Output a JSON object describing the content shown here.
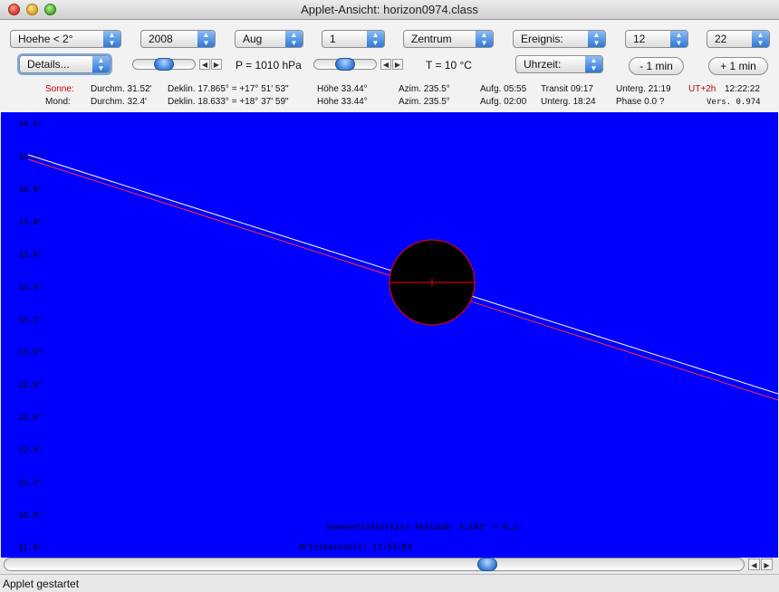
{
  "window": {
    "title": "Applet-Ansicht: horizon0974.class"
  },
  "controls": {
    "height_select": "Hoehe < 2°",
    "year_select": "2008",
    "month_select": "Aug",
    "day_select": "1",
    "center_select": "Zentrum",
    "event_select": "Ereignis:",
    "hour_select": "12",
    "minute_select": "22",
    "details_select": "Details...",
    "time_select": "Uhrzeit:",
    "pressure_label": "P = 1010 hPa",
    "temperature_label": "T = 10 °C",
    "minus_button": "- 1 min",
    "plus_button": "+ 1 min"
  },
  "sun": {
    "label": "Sonne:",
    "diameter": "Durchm. 31.52'",
    "declination": "Deklin. 17.865° = +17° 51' 53\"",
    "altitude": "Höhe 33.44°",
    "azimuth": "Azim. 235.5°",
    "rise": "Aufg. 05:55",
    "transit": "Transit 09:17",
    "set": "Unterg. 21:19",
    "timezone": "UT+2h",
    "clock": "12:22:22"
  },
  "moon": {
    "label": "Mond:",
    "diameter": "Durchm. 32.4'",
    "declination": "Deklin. 18.633° = +18° 37' 59\"",
    "altitude": "Höhe 33.44°",
    "azimuth": "Azim. 235.5°",
    "rise": "Aufg. 02:00",
    "set": "Unterg. 18:24",
    "phase": "Phase 0.0 ?",
    "version": "Vers. 0.974"
  },
  "sky": {
    "y_ticks": [
      "34.4°",
      "34.2°",
      "34.0°",
      "33.8°",
      "33.6°",
      "33.4°",
      "33.2°",
      "33.0°",
      "32.8°",
      "32.6°",
      "32.4°",
      "32.2°",
      "32.0°",
      "31.8°"
    ],
    "eclipse_text": "Sonnenfinsternis? Abstand: 0.103° = 6.2'",
    "sidereal_text": "Ortssternzeit: 11:53:03",
    "colors": {
      "background": "#0000ff",
      "disc": "#000000",
      "rim": "#ff0000",
      "path_sun": "#ff3030",
      "path_moon": "#ffffff"
    }
  },
  "status": {
    "text": "Applet gestartet"
  }
}
